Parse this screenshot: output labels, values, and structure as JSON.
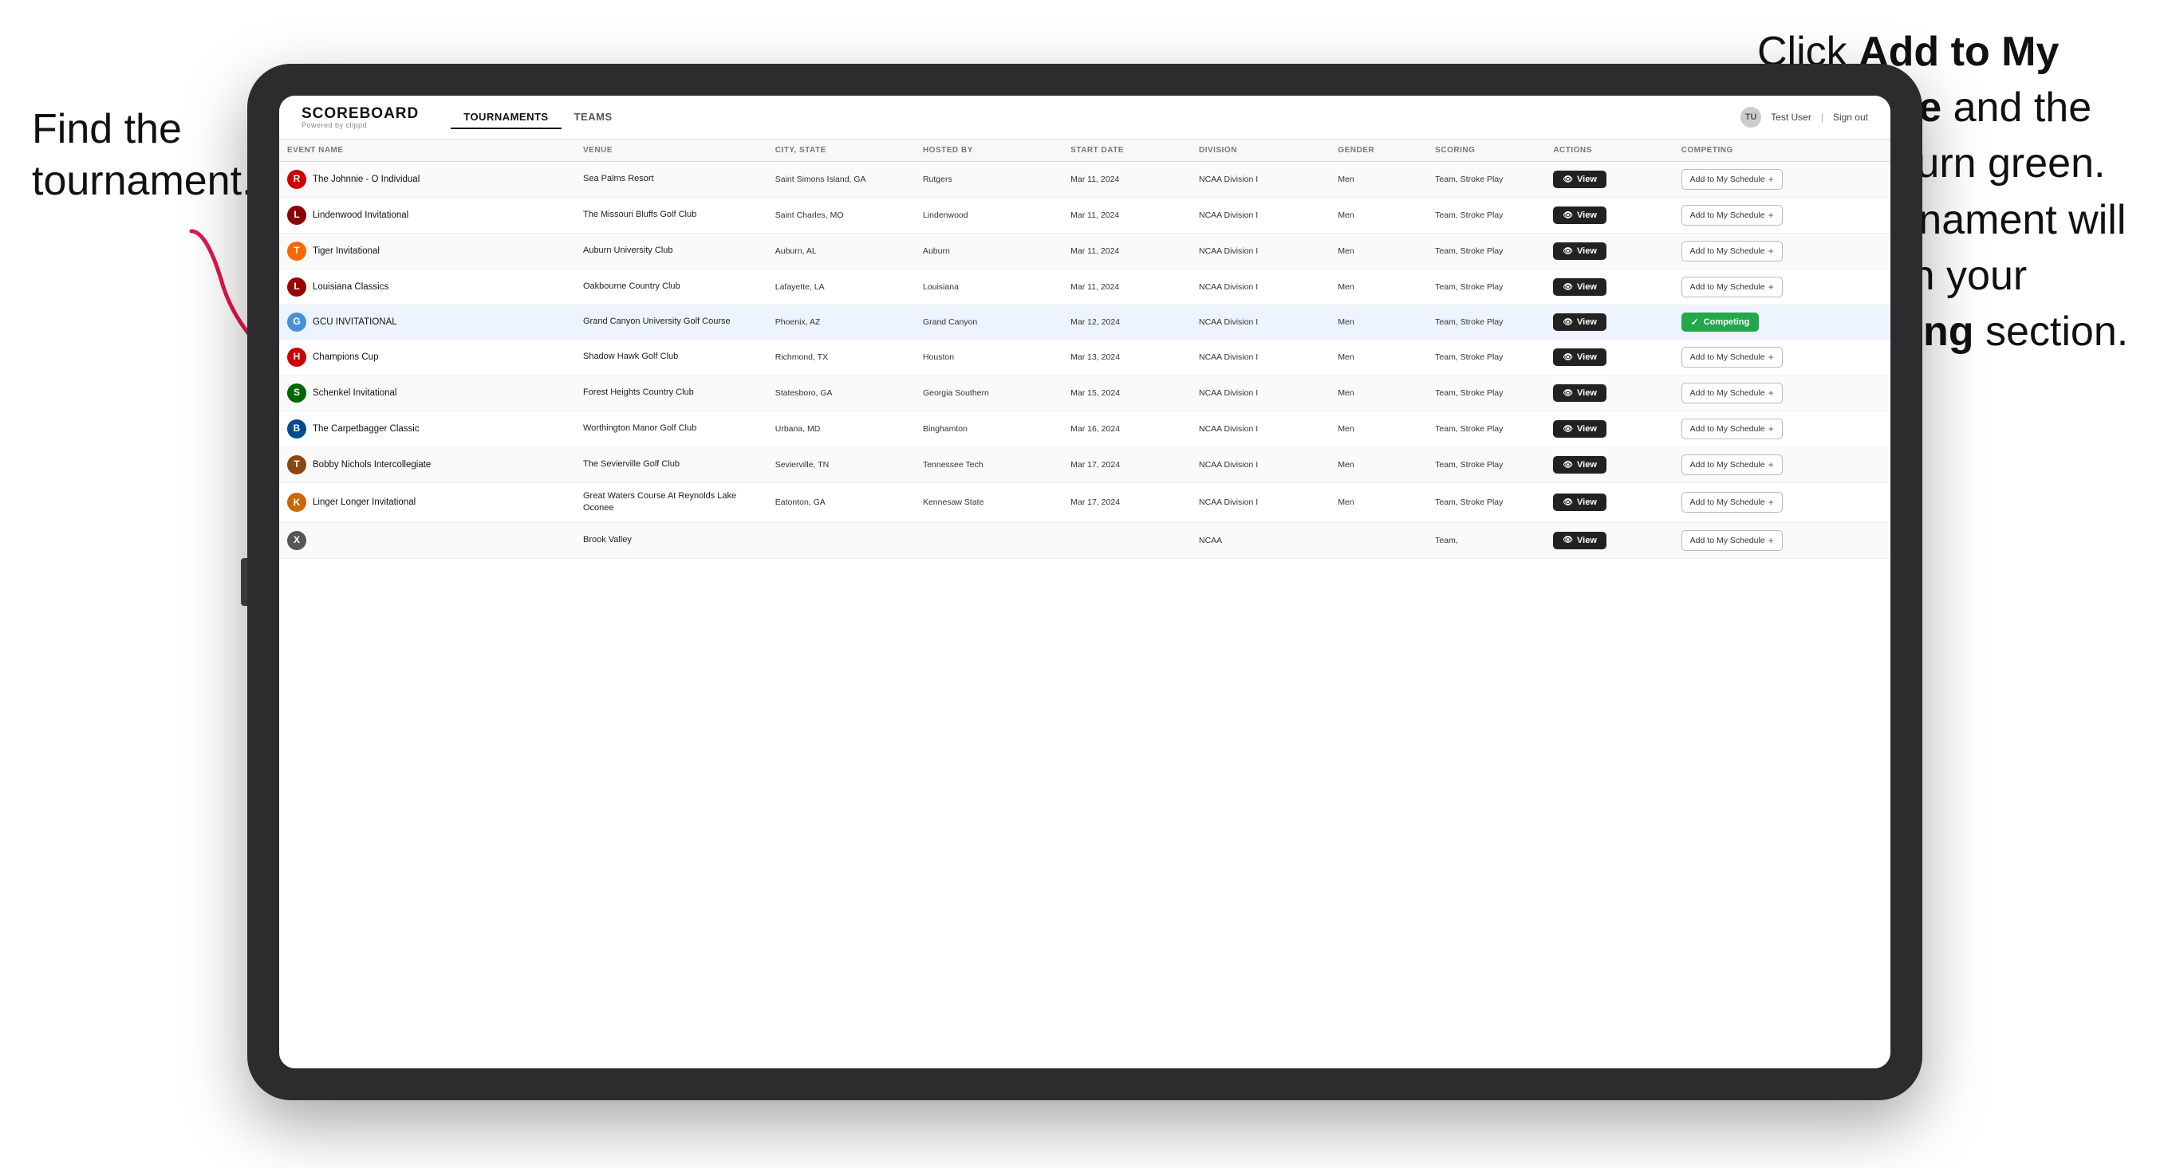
{
  "annotations": {
    "left": "Find the tournament.",
    "right_part1": "Click ",
    "right_bold1": "Add to My Schedule",
    "right_part2": " and the box will turn green. This tournament will now be in your ",
    "right_bold2": "Competing",
    "right_part3": " section."
  },
  "header": {
    "logo": "SCOREBOARD",
    "logo_sub": "Powered by clippd",
    "nav": [
      "TOURNAMENTS",
      "TEAMS"
    ],
    "active_nav": "TOURNAMENTS",
    "user": "Test User",
    "sign_out": "Sign out"
  },
  "table": {
    "columns": [
      "EVENT NAME",
      "VENUE",
      "CITY, STATE",
      "HOSTED BY",
      "START DATE",
      "DIVISION",
      "GENDER",
      "SCORING",
      "ACTIONS",
      "COMPETING"
    ],
    "rows": [
      {
        "logo_color": "#cc0000",
        "logo_letter": "R",
        "event_name": "The Johnnie - O Individual",
        "venue": "Sea Palms Resort",
        "city_state": "Saint Simons Island, GA",
        "hosted_by": "Rutgers",
        "start_date": "Mar 11, 2024",
        "division": "NCAA Division I",
        "gender": "Men",
        "scoring": "Team, Stroke Play",
        "competing_status": "add",
        "highlighted": false
      },
      {
        "logo_color": "#8B0000",
        "logo_letter": "L",
        "event_name": "Lindenwood Invitational",
        "venue": "The Missouri Bluffs Golf Club",
        "city_state": "Saint Charles, MO",
        "hosted_by": "Lindenwood",
        "start_date": "Mar 11, 2024",
        "division": "NCAA Division I",
        "gender": "Men",
        "scoring": "Team, Stroke Play",
        "competing_status": "add",
        "highlighted": false
      },
      {
        "logo_color": "#FF6600",
        "logo_letter": "T",
        "event_name": "Tiger Invitational",
        "venue": "Auburn University Club",
        "city_state": "Auburn, AL",
        "hosted_by": "Auburn",
        "start_date": "Mar 11, 2024",
        "division": "NCAA Division I",
        "gender": "Men",
        "scoring": "Team, Stroke Play",
        "competing_status": "add",
        "highlighted": false
      },
      {
        "logo_color": "#990000",
        "logo_letter": "L",
        "event_name": "Louisiana Classics",
        "venue": "Oakbourne Country Club",
        "city_state": "Lafayette, LA",
        "hosted_by": "Louisiana",
        "start_date": "Mar 11, 2024",
        "division": "NCAA Division I",
        "gender": "Men",
        "scoring": "Team, Stroke Play",
        "competing_status": "add",
        "highlighted": false
      },
      {
        "logo_color": "#4a90d9",
        "logo_letter": "G",
        "event_name": "GCU INVITATIONAL",
        "venue": "Grand Canyon University Golf Course",
        "city_state": "Phoenix, AZ",
        "hosted_by": "Grand Canyon",
        "start_date": "Mar 12, 2024",
        "division": "NCAA Division I",
        "gender": "Men",
        "scoring": "Team, Stroke Play",
        "competing_status": "competing",
        "highlighted": true
      },
      {
        "logo_color": "#cc0000",
        "logo_letter": "H",
        "event_name": "Champions Cup",
        "venue": "Shadow Hawk Golf Club",
        "city_state": "Richmond, TX",
        "hosted_by": "Houston",
        "start_date": "Mar 13, 2024",
        "division": "NCAA Division I",
        "gender": "Men",
        "scoring": "Team, Stroke Play",
        "competing_status": "add",
        "highlighted": false
      },
      {
        "logo_color": "#006600",
        "logo_letter": "S",
        "event_name": "Schenkel Invitational",
        "venue": "Forest Heights Country Club",
        "city_state": "Statesboro, GA",
        "hosted_by": "Georgia Southern",
        "start_date": "Mar 15, 2024",
        "division": "NCAA Division I",
        "gender": "Men",
        "scoring": "Team, Stroke Play",
        "competing_status": "add",
        "highlighted": false
      },
      {
        "logo_color": "#004a8f",
        "logo_letter": "B",
        "event_name": "The Carpetbagger Classic",
        "venue": "Worthington Manor Golf Club",
        "city_state": "Urbana, MD",
        "hosted_by": "Binghamton",
        "start_date": "Mar 16, 2024",
        "division": "NCAA Division I",
        "gender": "Men",
        "scoring": "Team, Stroke Play",
        "competing_status": "add",
        "highlighted": false
      },
      {
        "logo_color": "#8B4513",
        "logo_letter": "T",
        "event_name": "Bobby Nichols Intercollegiate",
        "venue": "The Sevierville Golf Club",
        "city_state": "Sevierville, TN",
        "hosted_by": "Tennessee Tech",
        "start_date": "Mar 17, 2024",
        "division": "NCAA Division I",
        "gender": "Men",
        "scoring": "Team, Stroke Play",
        "competing_status": "add",
        "highlighted": false
      },
      {
        "logo_color": "#cc6600",
        "logo_letter": "K",
        "event_name": "Linger Longer Invitational",
        "venue": "Great Waters Course At Reynolds Lake Oconee",
        "city_state": "Eatonton, GA",
        "hosted_by": "Kennesaw State",
        "start_date": "Mar 17, 2024",
        "division": "NCAA Division I",
        "gender": "Men",
        "scoring": "Team, Stroke Play",
        "competing_status": "add",
        "highlighted": false
      },
      {
        "logo_color": "#555555",
        "logo_letter": "X",
        "event_name": "",
        "venue": "Brook Valley",
        "city_state": "",
        "hosted_by": "",
        "start_date": "",
        "division": "NCAA",
        "gender": "",
        "scoring": "Team,",
        "competing_status": "add",
        "highlighted": false
      }
    ],
    "btn_view_label": "View",
    "btn_add_label": "Add to My Schedule",
    "btn_competing_label": "Competing"
  }
}
